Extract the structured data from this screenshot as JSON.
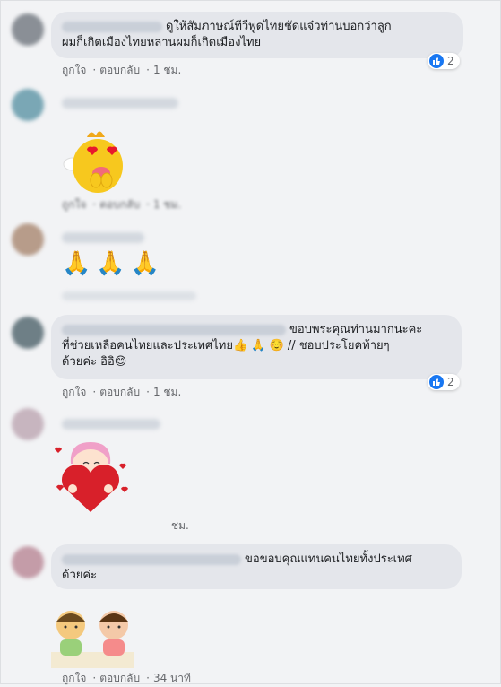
{
  "comments": [
    {
      "text": "ดูให้สัมภาษณ์ทีวีพูดไทยชัดแจ๋วท่านบอกว่าลูกผมก็เกิดเมืองไทยหลานผมก็เกิดเมืองไทย",
      "line1": "ดูให้สัมภาษณ์ทีวีพูดไทยชัดแจ๋วท่านบอกว่าลูก",
      "line2": "ผมก็เกิดเมืองไทยหลานผมก็เกิดเมืองไทย",
      "reaction_count": "2",
      "like": "ถูกใจ",
      "reply": "ตอบกลับ",
      "time": "1 ชม."
    },
    {
      "like": "ถูกใจ",
      "reply": "ตอบกลับ",
      "time": "1 ชม.",
      "sticker": "hearts-eyes-chick-sticker"
    },
    {
      "emoji": [
        "🙏",
        "🙏",
        "🙏"
      ]
    },
    {
      "line1": "ขอบพระคุณท่านมากนะคะ",
      "line2": "ที่ช่วยเหลือคนไทยและประเทศไทย👍 🙏 ☺️ // ชอบประโยคท้ายๆ",
      "line3": "ด้วยค่ะ อิอิ😊",
      "reaction_count": "2",
      "like": "ถูกใจ",
      "reply": "ตอบกลับ",
      "time": "1 ชม."
    },
    {
      "time": "ชม.",
      "sticker": "girl-hugging-heart-sticker"
    },
    {
      "line1": "ขอขอบคุณแทนคนไทยทั้งประเทศ",
      "line2": "ด้วยค่ะ",
      "like": "ถูกใจ",
      "reply": "ตอบกลับ",
      "time": "34 นาที",
      "sticker": "two-kids-sticker"
    }
  ],
  "colors": {
    "bubble": "#e4e6eb",
    "meta": "#65676b",
    "like_blue": "#1877f2",
    "background": "#f2f3f5"
  }
}
